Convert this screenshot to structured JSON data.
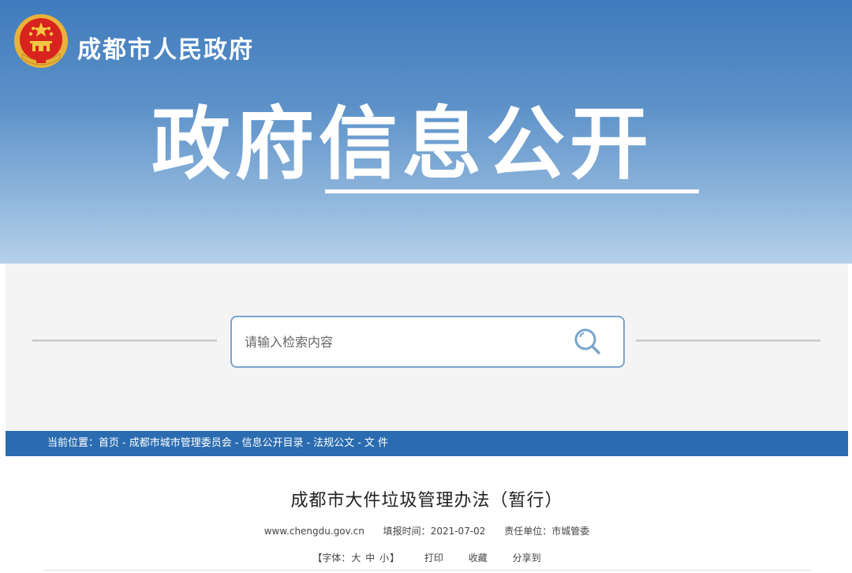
{
  "header": {
    "site_name": "成都市人民政府",
    "banner_title": "政府信息公开"
  },
  "search": {
    "placeholder": "请输入检索内容",
    "icon": "search-icon"
  },
  "breadcrumb": {
    "label": "当前位置：",
    "items": [
      "首页",
      "成都市城市管理委员会",
      "信息公开目录",
      "法规公文",
      "文 件"
    ],
    "separator": "-"
  },
  "article": {
    "title": "成都市大件垃圾管理办法（暂行）",
    "source": "www.chengdu.gov.cn",
    "date_label": "填报时间：",
    "date": "2021-07-02",
    "unit_label": "责任单位：",
    "unit": "市城管委"
  },
  "toolbar": {
    "font_open": "【字体：",
    "font_large": "大",
    "font_medium": "中",
    "font_small": "小",
    "font_close": "】",
    "print": "打印",
    "favorite": "收藏",
    "share": "分享到"
  },
  "colors": {
    "banner_top": "#3f7bbd",
    "banner_bottom": "#b6d0ea",
    "breadcrumb_bg": "#2b6cb0",
    "search_border": "#7aa4cc"
  }
}
